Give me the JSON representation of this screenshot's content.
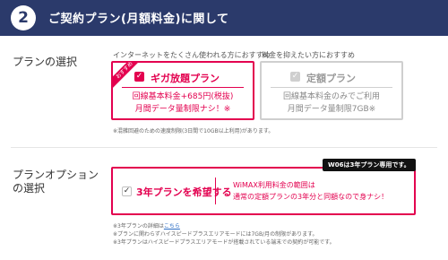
{
  "header": {
    "step_number": "2",
    "title": "ご契約プラン(月額料金)に関して"
  },
  "plan_section": {
    "label": "プランの選択",
    "giga": {
      "caption": "インターネットをたくさん使われる方におすすめ",
      "ribbon": "おすすめ",
      "name": "ギガ放題プラン",
      "line1": "回線基本料金+685円(税抜)",
      "line2": "月間データ量制限ナシ！※"
    },
    "teigaku": {
      "caption": "料金を抑えたい方におすすめ",
      "name": "定額プラン",
      "line1": "回線基本料金のみでご利用",
      "line2": "月間データ量制限7GB※"
    },
    "note": "※混雑回避のための速度制限(3日間で10GB以上利用)があります。"
  },
  "option_section": {
    "label_line1": "プランオプション",
    "label_line2": "の選択",
    "badge": "W06は3年プラン専用です。",
    "checkbox_label": "3年プランを希望する",
    "checkbox_mark": "✓",
    "desc_line1": "WiMAX利用料金の範囲は",
    "desc_line2": "通常の定額プランの3年分と同額なので身ナシ！",
    "notes": {
      "note1_prefix": "※3年プランの詳細は",
      "note1_link": "こちら",
      "note2": "※プランに関わらずハイスピードプラスエリアモードには7GB/月の制限があります。",
      "note3": "※3年プランはハイスピードプラスエリアモードが搭載されている端末での契約が可能です。"
    }
  },
  "colors": {
    "header_bg": "#2b3a6b",
    "accent": "#e3004f",
    "muted": "#cfcfcf"
  }
}
